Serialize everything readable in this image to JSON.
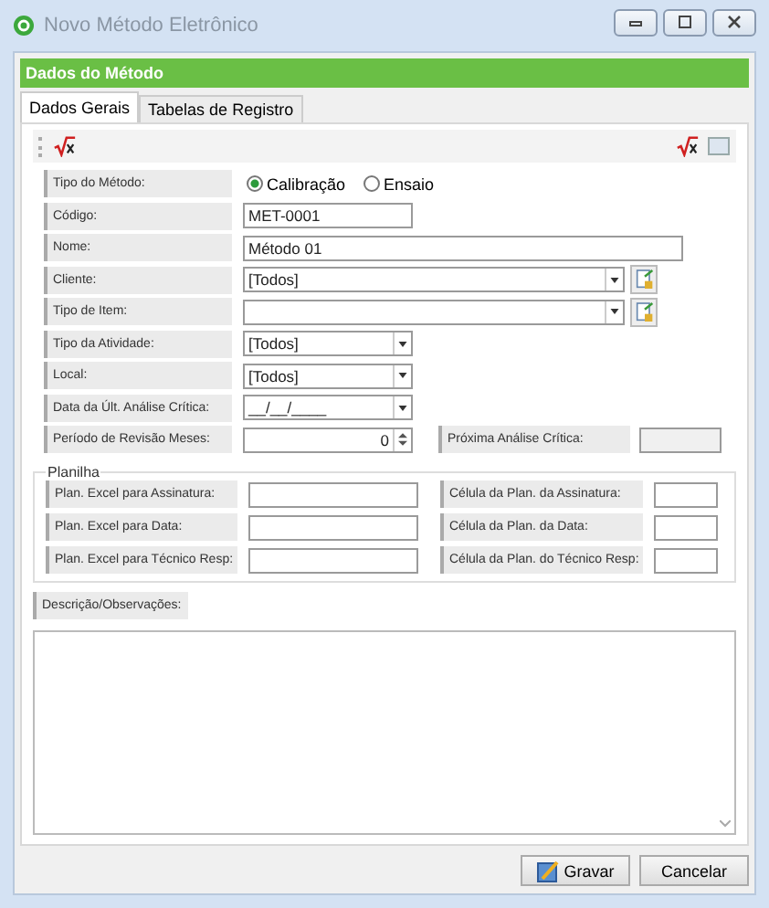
{
  "window": {
    "title": "Novo Método Eletrônico"
  },
  "header": "Dados do Método",
  "tabs": [
    {
      "label": "Dados Gerais",
      "selected": true
    },
    {
      "label": "Tabelas de Registro",
      "selected": false
    }
  ],
  "fields": [
    {
      "kind": "radio",
      "label": "Tipo do Método:",
      "options": [
        {
          "label": "Calibração",
          "selected": true
        },
        {
          "label": "Ensaio",
          "selected": false
        }
      ]
    },
    {
      "kind": "text",
      "label": "Código:",
      "value": "MET-0001"
    },
    {
      "kind": "text-wide",
      "label": "Nome:",
      "value": "Método 01"
    },
    {
      "kind": "combo-wide",
      "label": "Cliente:",
      "value": "[Todos]"
    },
    {
      "kind": "combo-wide",
      "label": "Tipo de Item:"
    },
    {
      "kind": "combo",
      "label": "Tipo da Atividade:",
      "value": "[Todos]"
    },
    {
      "kind": "combo",
      "label": "Local:",
      "value": "[Todos]"
    },
    {
      "kind": "combo",
      "label": "Data da Últ. Análise Crítica:",
      "value": "__/__/____"
    },
    {
      "kind": "spin",
      "label": "Período de Revisão Meses:",
      "value": "0",
      "side_label": "Próxima Análise Crítica:"
    }
  ],
  "planilha": {
    "title": "Planilha",
    "rows": [
      {
        "left": "Plan. Excel para Assinatura:",
        "right": "Célula da Plan. da Assinatura:"
      },
      {
        "left": "Plan. Excel para Data:",
        "right": "Célula da Plan. da Data:"
      },
      {
        "left": "Plan. Excel para Técnico Resp:",
        "right": "Célula da Plan. do Técnico Resp:"
      }
    ]
  },
  "description": {
    "label": "Descrição/Observações:"
  },
  "buttons": [
    {
      "kind": "save",
      "label": "Gravar"
    },
    {
      "kind": "cancel",
      "label": "Cancelar"
    }
  ]
}
